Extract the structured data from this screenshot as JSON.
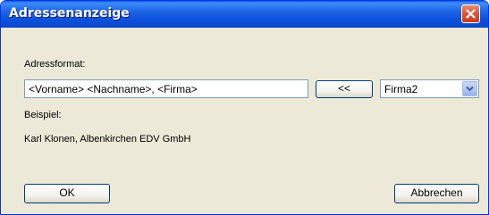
{
  "window": {
    "title": "Adressenanzeige"
  },
  "form": {
    "format_label": "Adressformat:",
    "format_value": "<Vorname> <Nachname>, <Firma>",
    "insert_button_label": "<<",
    "field_select_value": "Firma2",
    "example_label": "Beispiel:",
    "example_value": "Karl Klonen, Albenkirchen EDV GmbH"
  },
  "buttons": {
    "ok_label": "OK",
    "cancel_label": "Abbrechen"
  },
  "icons": {
    "close": "close-icon",
    "dropdown": "chevron-down-icon"
  },
  "colors": {
    "titlebar": "#0b5ce6",
    "close_button": "#d9502f",
    "dialog_bg": "#ece9d8"
  }
}
